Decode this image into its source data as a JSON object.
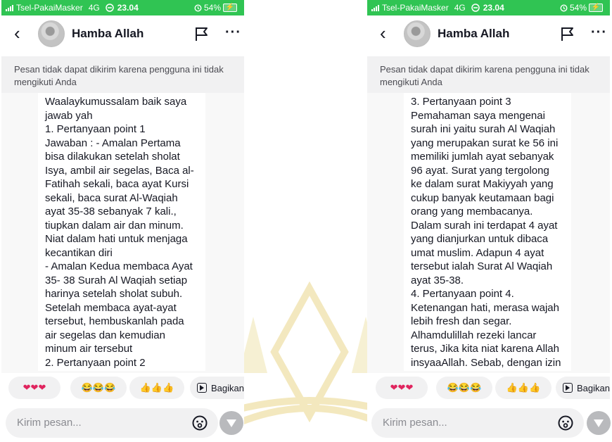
{
  "left": {
    "status": {
      "carrier": "Tsel-PakaiMasker",
      "network": "4G",
      "time": "23.04",
      "battery": "54%"
    },
    "contact": {
      "name": "Hamba Allah"
    },
    "notice": [
      "Pesan tidak dapat dikirim karena pengguna ini tidak",
      "mengikuti Anda"
    ],
    "message_lines": [
      "Waalaykumussalam baik saya",
      "jawab yah",
      "1. Pertanyaan point 1",
      "Jawaban : - Amalan Pertama",
      "bisa dilakukan setelah sholat",
      "Isya, ambil air segelas, Baca al-",
      "Fatihah sekali, baca ayat Kursi",
      "sekali, baca surat Al-Waqiah",
      "ayat 35-38 sebanyak 7 kali.,",
      "tiupkan dalam air dan minum.",
      "Niat dalam hati untuk menjaga",
      "kecantikan diri",
      "- Amalan Kedua membaca Ayat",
      "35- 38 Surah Al Waqiah setiap",
      "harinya setelah sholat subuh.",
      "Setelah membaca ayat-ayat",
      "tersebut, hembuskanlah pada",
      "air segelas dan kemudian",
      "minum air tersebut",
      "2. Pertanyaan point 2"
    ],
    "reactions": [
      "❤❤❤",
      "😂😂😂",
      "👍👍👍"
    ],
    "share_label": "Bagikan p",
    "input_placeholder": "Kirim pesan..."
  },
  "right": {
    "status": {
      "carrier": "Tsel-PakaiMasker",
      "network": "4G",
      "time": "23.04",
      "battery": "54%"
    },
    "contact": {
      "name": "Hamba Allah"
    },
    "notice": [
      "Pesan tidak dapat dikirim karena pengguna ini tidak",
      "mengikuti Anda"
    ],
    "message_lines": [
      "3. Pertanyaan point 3",
      "Pemahaman saya mengenai",
      "surah ini yaitu surah Al Waqiah",
      "yang merupakan surat ke 56 ini",
      "memiliki jumlah ayat sebanyak",
      "96 ayat. Surat yang tergolong",
      "ke dalam surat Makiyyah yang",
      "cukup banyak keutamaan bagi",
      "orang yang membacanya.",
      "Dalam surah ini terdapat 4 ayat",
      "yang dianjurkan untuk dibaca",
      "umat muslim. Adapun 4 ayat",
      "tersebut ialah Surat Al Waqiah",
      "ayat 35-38.",
      "4. Pertanyaan point 4.",
      "Ketenangan hati, merasa wajah",
      "lebih fresh dan segar.",
      "Alhamdulillah rezeki lancar",
      "terus, Jika kita niat karena Allah",
      "insyaaAllah. Sebab, dengan izin"
    ],
    "reactions": [
      "❤❤❤",
      "😂😂😂",
      "👍👍👍"
    ],
    "share_label": "Bagikan",
    "input_placeholder": "Kirim pesan..."
  },
  "colors": {
    "status_bar": "#30c453",
    "notice_bg": "#f1f1f2",
    "chip_bg": "#f1f1f2",
    "send_button": "#b9babd",
    "text": "#161823",
    "watermark": "#f2e6b8"
  },
  "icons": [
    "signal-icon",
    "data-saver-icon",
    "battery-charging-icon",
    "back-arrow-icon",
    "flag-icon",
    "more-icon",
    "share-icon",
    "emoji-icon",
    "send-icon"
  ]
}
